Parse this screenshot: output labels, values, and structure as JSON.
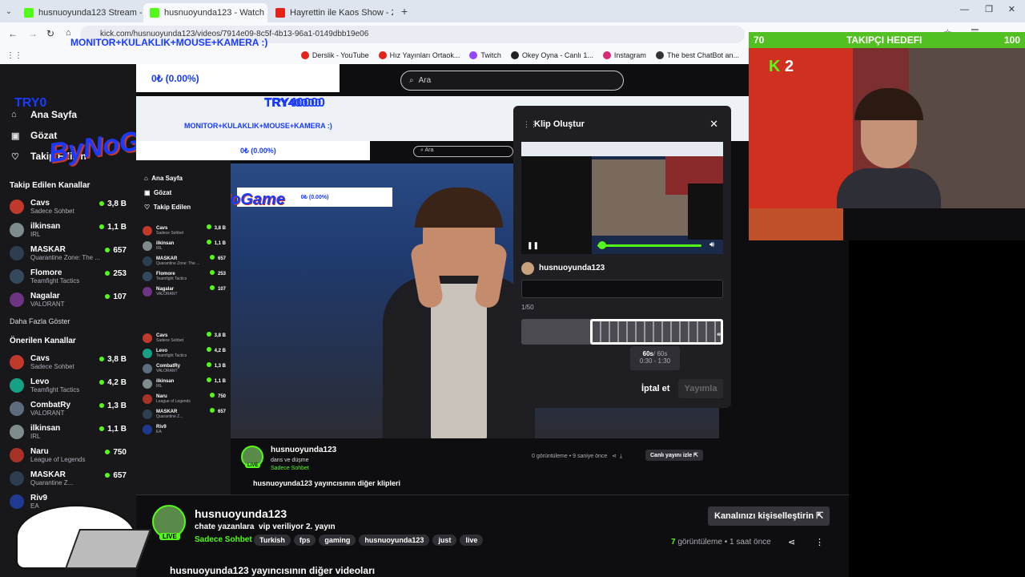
{
  "browser": {
    "tabs": [
      {
        "title": "husnuoyunda123 Stream - Wat",
        "active": false
      },
      {
        "title": "husnuoyunda123 - Watch I",
        "active": true
      },
      {
        "title": "Hayrettin ile Kaos Show - 2.Se",
        "active": false
      }
    ],
    "url": "kick.com/husnuoyunda123/videos/7914e09-8c5f-4b13-96a1-0149dbb19e06",
    "bookmarks": [
      "Derslik - YouTube",
      "Hız Yayınları Ortaok...",
      "Twitch",
      "Okey Oyna - Canlı 1...",
      "Instagram",
      "The best ChatBot an..."
    ]
  },
  "overlay": {
    "headline": "MONITOR+KULAKLIK+MOUSE+KAMERA :)",
    "donation": "0₺ (0.00%)",
    "try_left": "TRY0",
    "try_right": "TRY40000",
    "logo": "ByNoGame",
    "goal_label": "TAKIPÇI HEDEFI",
    "goal_current": "70",
    "goal_target": "100",
    "kick_badge": "2"
  },
  "search": {
    "placeholder": "Ara"
  },
  "sidebar": {
    "nav": [
      {
        "label": "Ana Sayfa",
        "icon": "home-icon"
      },
      {
        "label": "Gözat",
        "icon": "browse-icon"
      },
      {
        "label": "Takip Edilen",
        "icon": "heart-icon"
      }
    ],
    "followed_title": "Takip Edilen Kanallar",
    "followed": [
      {
        "name": "Cavs",
        "game": "Sadece Sohbet",
        "viewers": "3,8 B",
        "color": "#c0392b"
      },
      {
        "name": "ilkinsan",
        "game": "IRL",
        "viewers": "1,1 B",
        "color": "#7f8c8d"
      },
      {
        "name": "MASKAR",
        "game": "Quarantine Zone: The ...",
        "viewers": "657",
        "color": "#2c3e50"
      },
      {
        "name": "Flomore",
        "game": "Teamfight Tactics",
        "viewers": "253",
        "color": "#34495e"
      },
      {
        "name": "Nagalar",
        "game": "VALORANT",
        "viewers": "107",
        "color": "#6c3483"
      }
    ],
    "show_more": "Daha Fazla Göster",
    "recommended_title": "Önerilen Kanallar",
    "recommended": [
      {
        "name": "Cavs",
        "game": "Sadece Sohbet",
        "viewers": "3,8 B",
        "color": "#c0392b"
      },
      {
        "name": "Levo",
        "game": "Teamfight Tactics",
        "viewers": "4,2 B",
        "color": "#16a085"
      },
      {
        "name": "CombatRy",
        "game": "VALORANT",
        "viewers": "1,3 B",
        "color": "#5d6d7e"
      },
      {
        "name": "ilkinsan",
        "game": "IRL",
        "viewers": "1,1 B",
        "color": "#7f8c8d"
      },
      {
        "name": "Naru",
        "game": "League of Legends",
        "viewers": "750",
        "color": "#a93226"
      },
      {
        "name": "MASKAR",
        "game": "Quarantine Z...",
        "viewers": "657",
        "color": "#2c3e50"
      },
      {
        "name": "Riv9",
        "game": "EA",
        "viewers": "",
        "color": "#1f3a93"
      }
    ]
  },
  "clip_modal": {
    "title": "Klip Oluştur",
    "user": "husnuoyunda123",
    "counter": "1/50",
    "duration": "60s",
    "duration_max": "/ 60s",
    "range": "0:30 - 1:30",
    "cancel": "İptal et",
    "publish": "Yayımla"
  },
  "nested_info": {
    "channel": "husnuoyunda123",
    "subtitle": "dans ve düşme",
    "category": "Sadece Sohbet",
    "views": "0 görüntüleme",
    "ago": "9 saniye önce",
    "watch_live": "Canlı yayını izle",
    "clips_title": "husnuoyunda123 yayıncısının diğer klipleri"
  },
  "channel_info": {
    "name": "husnuoyunda123",
    "title": "chate yazanlara  vip veriliyor 2. yayın",
    "category": "Sadece Sohbet",
    "tags": [
      "Turkish",
      "fps",
      "gaming",
      "husnuoyunda123",
      "just",
      "live"
    ],
    "views_count": "7",
    "views_label": "görüntüleme",
    "ago": "1 saat önce",
    "customize": "Kanalınızı kişiselleştirin",
    "live": "LIVE",
    "videos_title": "husnuoyunda123 yayıncısının diğer videoları"
  },
  "colors": {
    "kick_green": "#53fc18",
    "accent_blue": "#1a3bff"
  }
}
